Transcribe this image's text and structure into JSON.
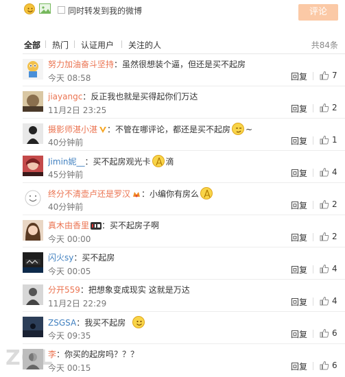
{
  "toolbar": {
    "emoji_icon": "smile-icon",
    "image_icon": "picture-icon",
    "repost_label": "同时转发到我的微博",
    "comment_button": "评论"
  },
  "filter": {
    "tabs": [
      "全部",
      "热门",
      "认证用户",
      "关注的人"
    ],
    "count": "共84条"
  },
  "colors": {
    "username": "#eb7350",
    "username_blue": "#3f7fbf",
    "comment_button_bg": "#fbc9a6"
  },
  "comments": [
    {
      "user": "努力加油奋斗坚持",
      "sep": "：",
      "text": "虽然很想装个逼，但还是买不起房",
      "after": "",
      "time": "今天 08:58",
      "reply": "回复",
      "likes": "7"
    },
    {
      "user": "jiayangc",
      "sep": "：",
      "text": "反正我也就是买得起你们万达",
      "after": "",
      "time": "11月2日 23:25",
      "reply": "回复",
      "likes": "2"
    },
    {
      "user": "摄影师湛小湛",
      "sep": "：",
      "text": "不管在哪评论，都还是买不起房",
      "after": "~",
      "time": "40分钟前",
      "reply": "回复",
      "likes": "1"
    },
    {
      "user": "Jimin妮__",
      "sep": "：",
      "text": "买不起房观光卡",
      "after": "滴",
      "time": "45分钟前",
      "reply": "回复",
      "likes": "4"
    },
    {
      "user": "终分不清壶卢还是罗汉",
      "sep": "：",
      "text": "小编你有房么",
      "after": "",
      "time": "40分钟前",
      "reply": "回复",
      "likes": "2"
    },
    {
      "user": "真木由香里",
      "sep": "：",
      "text": "买不起房子啊",
      "after": "",
      "time": "今天 00:00",
      "reply": "回复",
      "likes": "2"
    },
    {
      "user": "闪火sy",
      "sep": "：",
      "text": "买不起房",
      "after": "",
      "time": "今天 00:05",
      "reply": "回复",
      "likes": "4"
    },
    {
      "user": "分开559",
      "sep": "：",
      "text": "把想象变成现实 这就是万达",
      "after": "",
      "time": "11月2日 22:29",
      "reply": "回复",
      "likes": "4"
    },
    {
      "user": "ZSGSA",
      "sep": "：",
      "text": "我买不起房",
      "after": "",
      "time": "今天 09:35",
      "reply": "回复",
      "likes": "6"
    },
    {
      "user": "李",
      "sep": "：",
      "text": "你买的起房吗？？？",
      "after": "",
      "time": "今天 00:15",
      "reply": "回复",
      "likes": "6"
    }
  ],
  "watermark": "ZOL"
}
